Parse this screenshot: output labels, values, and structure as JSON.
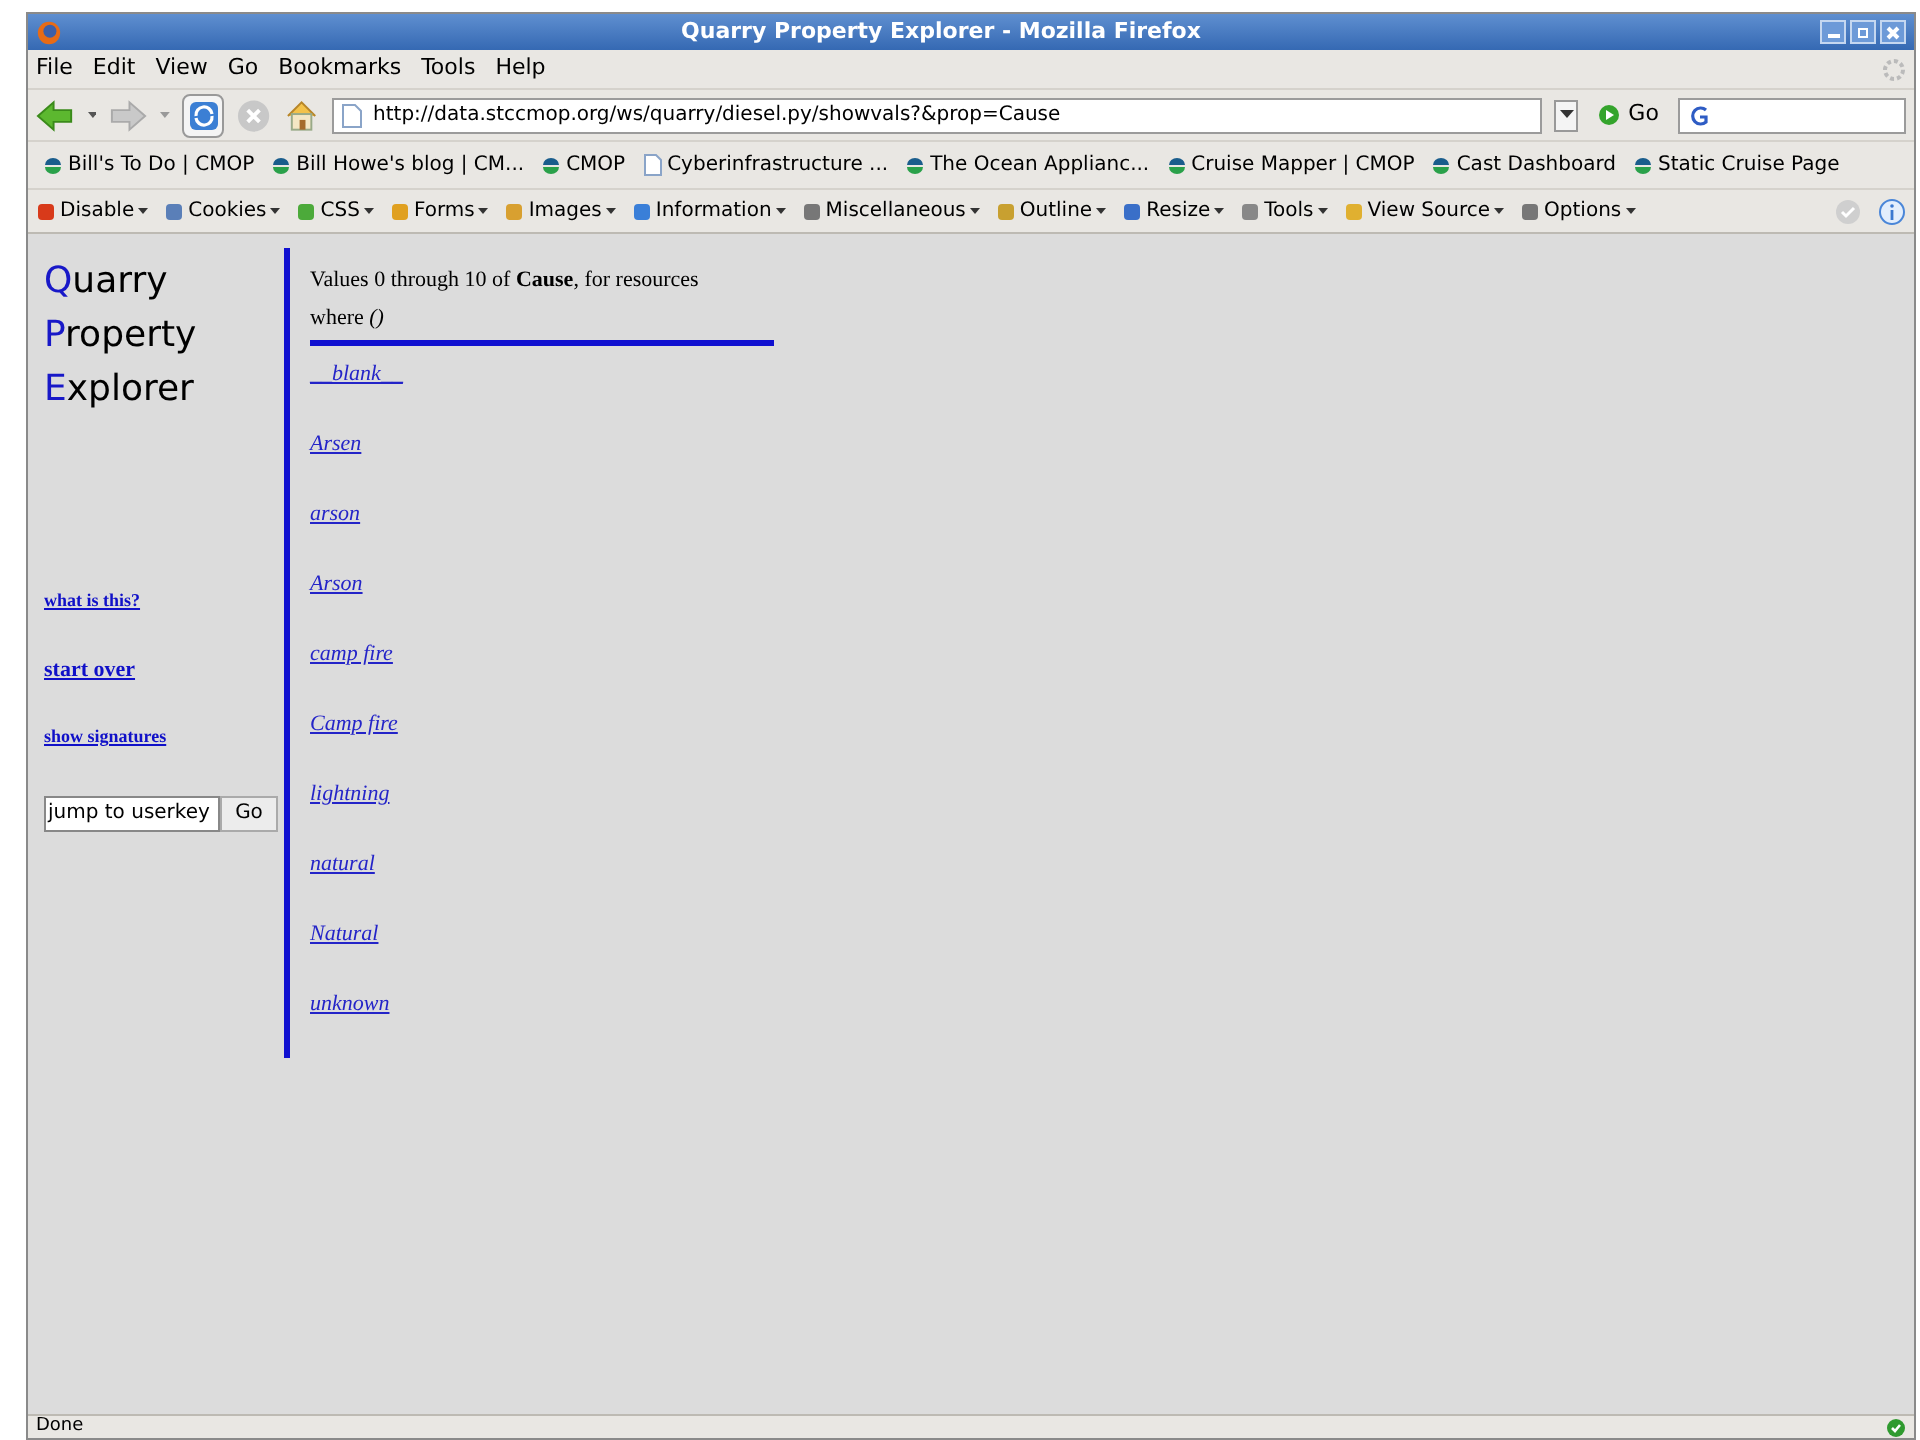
{
  "window": {
    "title": "Quarry Property Explorer - Mozilla Firefox"
  },
  "menu": [
    "File",
    "Edit",
    "View",
    "Go",
    "Bookmarks",
    "Tools",
    "Help"
  ],
  "navigation": {
    "url": "http://data.stccmop.org/ws/quarry/diesel.py/showvals?&prop=Cause",
    "go": "Go"
  },
  "bookmarks": [
    {
      "label": "Bill's To Do | CMOP",
      "kind": "site"
    },
    {
      "label": "Bill Howe's blog | CM...",
      "kind": "site"
    },
    {
      "label": "CMOP",
      "kind": "site"
    },
    {
      "label": "Cyberinfrastructure ...",
      "kind": "page"
    },
    {
      "label": "The Ocean Applianc...",
      "kind": "site"
    },
    {
      "label": "Cruise Mapper | CMOP",
      "kind": "site"
    },
    {
      "label": "Cast Dashboard",
      "kind": "site"
    },
    {
      "label": "Static Cruise Page",
      "kind": "site"
    }
  ],
  "dev_toolbar": [
    "Disable",
    "Cookies",
    "CSS",
    "Forms",
    "Images",
    "Information",
    "Miscellaneous",
    "Outline",
    "Resize",
    "Tools",
    "View Source",
    "Options"
  ],
  "sidebar": {
    "title_words": [
      "Quarry",
      "Property",
      "Explorer"
    ],
    "links": [
      {
        "label": "what is this?",
        "kind": "small"
      },
      {
        "label": "start over",
        "kind": "large"
      },
      {
        "label": "show signatures",
        "kind": "small"
      }
    ],
    "jump": {
      "value": "jump to userkey",
      "button": "Go"
    }
  },
  "content": {
    "summary": "Values 0 through 10 of **Cause**, for resources",
    "where": "where *()*",
    "values": [
      "__blank__",
      "Arsen",
      "arson",
      "Arson",
      "camp fire",
      "Camp fire",
      "lightning",
      "natural",
      "Natural",
      "unknown"
    ]
  },
  "status_bar": {
    "text": "Done"
  }
}
